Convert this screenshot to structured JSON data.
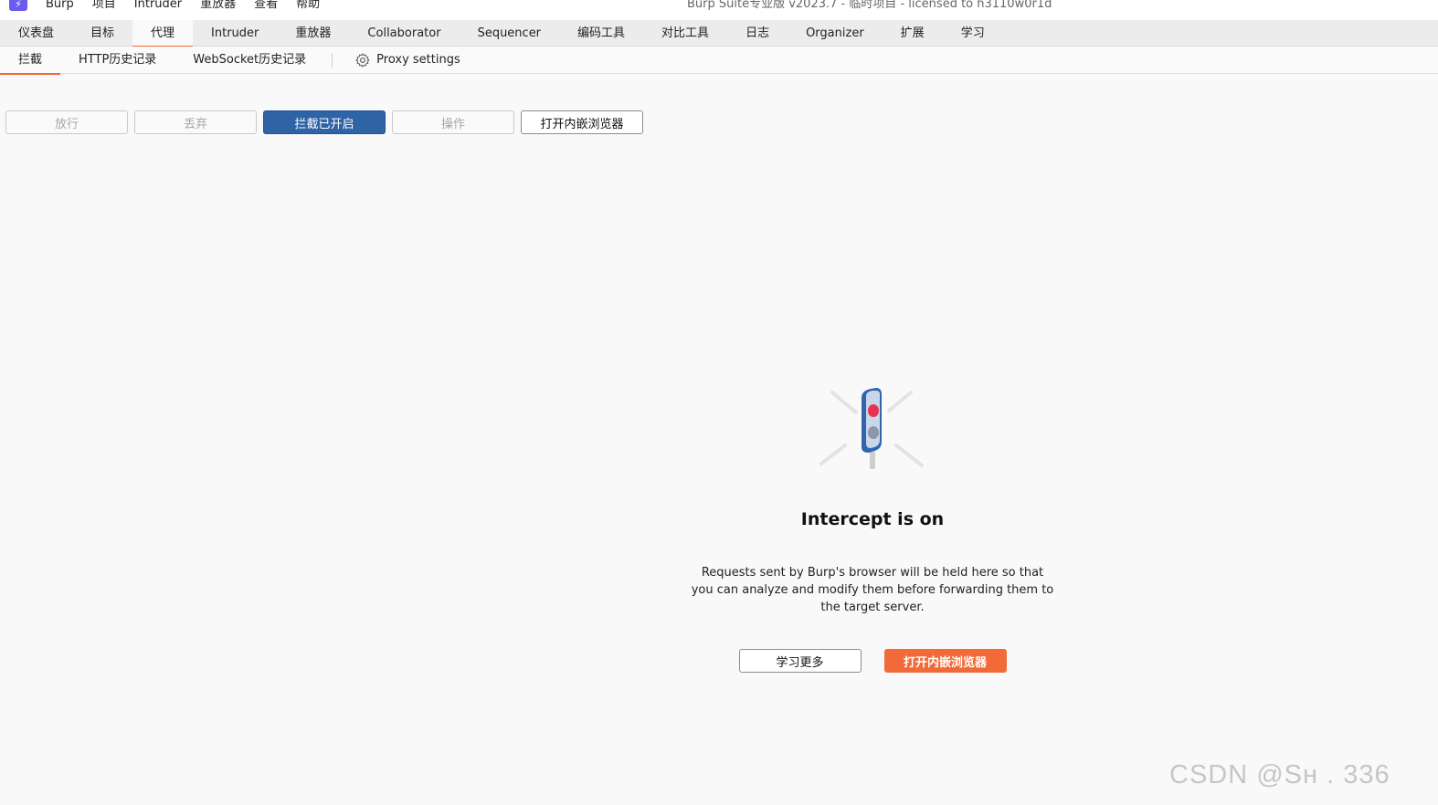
{
  "menubar": {
    "logo": "⚡",
    "items": [
      "Burp",
      "项目",
      "Intruder",
      "重放器",
      "查看",
      "帮助"
    ],
    "window_title": "Burp Suite专业版  v2023.7 - 临时项目 - licensed to h3110w0r1d"
  },
  "primary_tabs": [
    "仪表盘",
    "目标",
    "代理",
    "Intruder",
    "重放器",
    "Collaborator",
    "Sequencer",
    "编码工具",
    "对比工具",
    "日志",
    "Organizer",
    "扩展",
    "学习"
  ],
  "primary_active": "代理",
  "secondary_tabs": [
    "拦截",
    "HTTP历史记录",
    "WebSocket历史记录"
  ],
  "secondary_active": "拦截",
  "proxy_settings_label": "Proxy settings",
  "toolbar": {
    "forward": "放行",
    "drop": "丢弃",
    "intercept_toggle": "拦截已开启",
    "action": "操作",
    "open_browser": "打开内嵌浏览器"
  },
  "panel": {
    "headline": "Intercept is on",
    "description": "Requests sent by Burp's browser will be held here so that you can analyze and modify them before forwarding them to the target server.",
    "learn_more": "学习更多",
    "open_browser": "打开内嵌浏览器"
  },
  "watermark": "CSDN @Sн     . 336",
  "colors": {
    "accent": "#f26a37",
    "primary_button": "#2e63a6",
    "logo": "#6b5cf0"
  }
}
